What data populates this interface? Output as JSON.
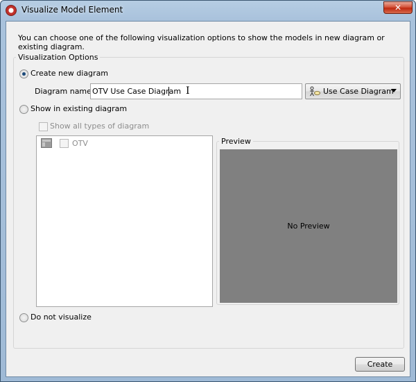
{
  "window": {
    "title": "Visualize Model Element",
    "close_symbol": "✕"
  },
  "intro": "You can choose one of the following visualization options to show the models in new diagram or existing diagram.",
  "options": {
    "legend": "Visualization Options",
    "create_new": {
      "label": "Create new diagram",
      "selected": true,
      "diagram_name_label": "Diagram name:",
      "diagram_name_value": "OTV Use Case Diagram",
      "diagram_type": "Use Case Diagram",
      "diagram_type_icon": "use-case-diagram-icon"
    },
    "show_existing": {
      "label": "Show in existing diagram",
      "selected": false,
      "show_all_types_label": "Show all types of diagram",
      "tree_items": [
        {
          "label": "OTV",
          "icon": "project-icon",
          "checked": false
        }
      ]
    },
    "preview": {
      "legend": "Preview",
      "placeholder": "No Preview"
    },
    "do_not_visualize": {
      "label": "Do not visualize",
      "selected": false
    }
  },
  "footer": {
    "create_label": "Create"
  }
}
